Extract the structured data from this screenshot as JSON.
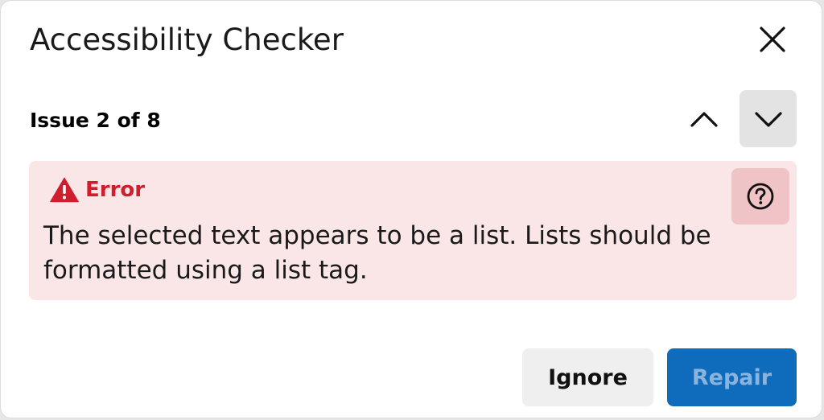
{
  "dialog": {
    "title": "Accessibility Checker",
    "close_icon": "close-icon"
  },
  "issue_nav": {
    "label": "Issue 2 of 8",
    "prev_icon": "chevron-up-icon",
    "next_icon": "chevron-down-icon"
  },
  "issue": {
    "severity": "Error",
    "severity_icon": "warning-triangle-icon",
    "severity_color": "#cf1f2e",
    "background_color": "#fae6e7",
    "message": "The selected text appears to be a list. Lists should be formatted using a list tag.",
    "help_icon": "help-circle-icon"
  },
  "actions": {
    "ignore_label": "Ignore",
    "repair_label": "Repair",
    "accent_color": "#0f6cbd"
  }
}
